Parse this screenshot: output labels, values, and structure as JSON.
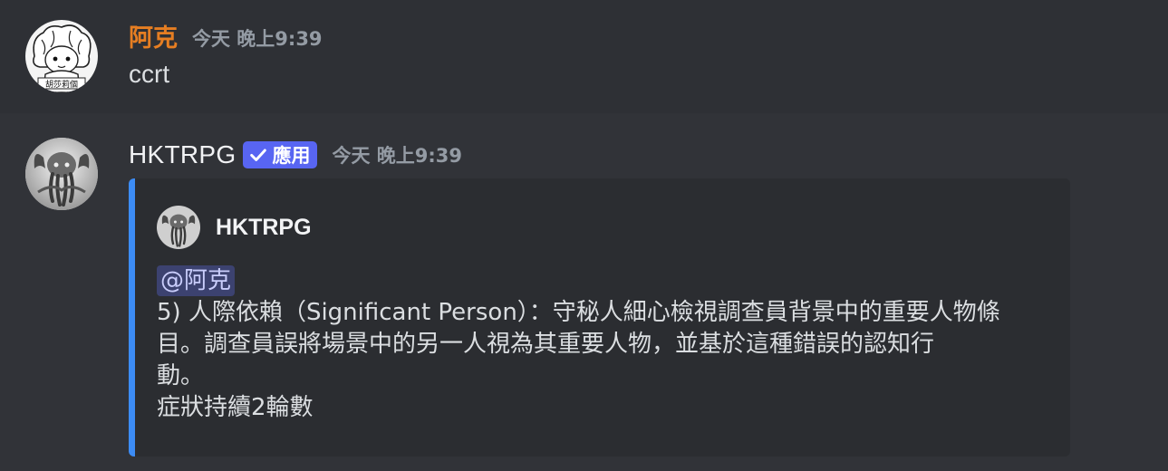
{
  "messages": [
    {
      "author": "阿克",
      "timestamp": "今天 晚上9:39",
      "content": "ccrt",
      "avatar_icon": "user-avatar-icon",
      "avatar_caption": "胡莎莉個",
      "author_color": "#e67e22"
    },
    {
      "author": "HKTRPG",
      "app_badge": "應用",
      "timestamp": "今天 晚上9:39",
      "avatar_icon": "bot-avatar-icon",
      "embed": {
        "border_color": "#3c8cf5",
        "author_name": "HKTRPG",
        "mention": "@阿克",
        "lines": [
          "5) 人際依賴（Significant Person）：守秘人細心檢視調查員背景中的重要人物條",
          "目。調查員誤將場景中的另一人視為其重要人物，並基於這種錯誤的認知行",
          "動。",
          "症狀持續2輪數"
        ]
      }
    }
  ],
  "colors": {
    "background": "#313338",
    "hover_background": "#2e3035",
    "embed_background": "#2b2d31",
    "badge": "#5865f2",
    "mention_bg": "#3c4270",
    "timestamp": "#949ba4"
  }
}
